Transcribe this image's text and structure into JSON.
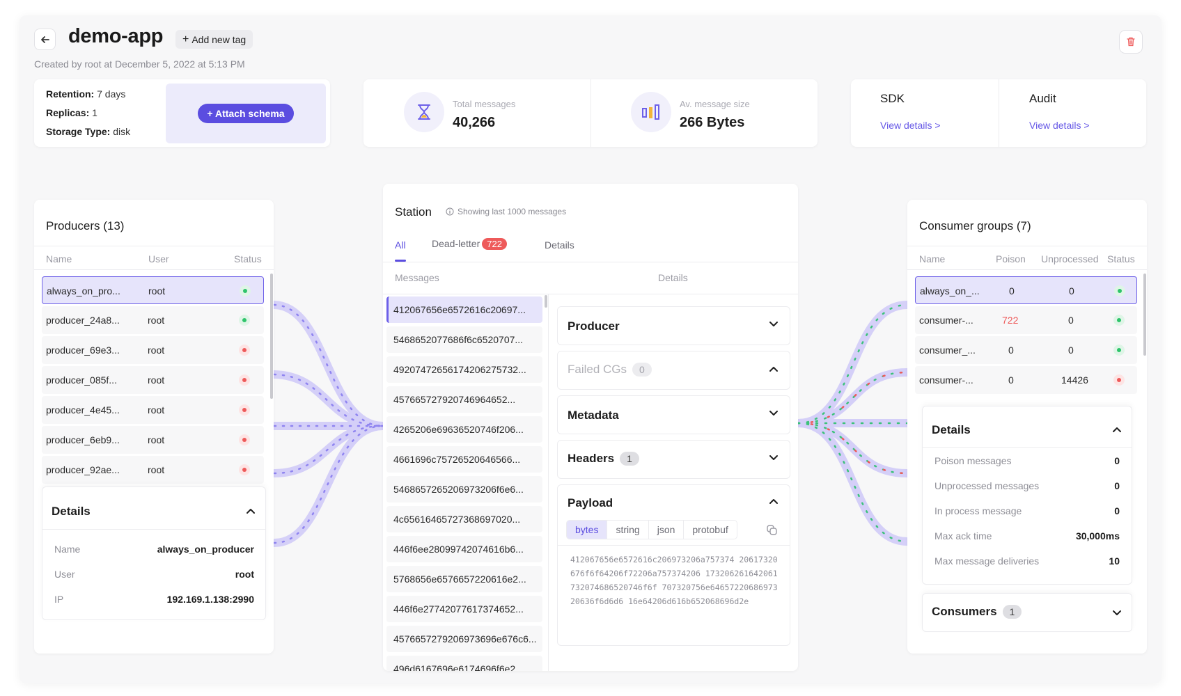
{
  "header": {
    "title": "demo-app",
    "add_tag_label": "Add new tag",
    "created": "Created by root at December 5, 2022 at 5:13 PM"
  },
  "info": {
    "retention_key": "Retention:",
    "retention_val": "7 days",
    "replicas_key": "Replicas:",
    "replicas_val": "1",
    "storage_key": "Storage Type:",
    "storage_val": "disk",
    "attach_schema_label": "+ Attach schema"
  },
  "stats": {
    "total_label": "Total messages",
    "total_value": "40,266",
    "size_label": "Av. message size",
    "size_value": "266 Bytes"
  },
  "links": {
    "sdk_title": "SDK",
    "sdk_link": "View details >",
    "audit_title": "Audit",
    "audit_link": "View details >"
  },
  "producers": {
    "title": "Producers (13)",
    "columns": [
      "Name",
      "User",
      "Status"
    ],
    "rows": [
      {
        "name": "always_on_pro...",
        "user": "root",
        "status": "ok"
      },
      {
        "name": "producer_24a8...",
        "user": "root",
        "status": "ok"
      },
      {
        "name": "producer_69e3...",
        "user": "root",
        "status": "bad"
      },
      {
        "name": "producer_085f...",
        "user": "root",
        "status": "bad"
      },
      {
        "name": "producer_4e45...",
        "user": "root",
        "status": "bad"
      },
      {
        "name": "producer_6eb9...",
        "user": "root",
        "status": "bad"
      },
      {
        "name": "producer_92ae...",
        "user": "root",
        "status": "bad"
      }
    ],
    "details": {
      "title": "Details",
      "name_key": "Name",
      "name_val": "always_on_producer",
      "user_key": "User",
      "user_val": "root",
      "ip_key": "IP",
      "ip_val": "192.169.1.138:2990"
    }
  },
  "station": {
    "title": "Station",
    "note": "Showing last 1000 messages",
    "tabs": {
      "all": "All",
      "dead_letter": "Dead-letter",
      "dead_letter_count": "722",
      "details": "Details"
    },
    "messages_header": "Messages",
    "details_header": "Details",
    "messages": [
      "412067656e6572616c20697...",
      "5468652077686f6c6520707...",
      "49207472656174206275732...",
      "457665727920746964652...",
      "4265206e69636520746f206...",
      "4661696c75726520646566...",
      "5468657265206973206f6e6...",
      "4c65616465727368697020...",
      "446f6ee28099742074616b6...",
      "5768656e6576657220616e2...",
      "446f6e27742077617374652...",
      "4576657279206973696e676c6...",
      "496d6167696e6174696f6e2..."
    ],
    "sections": {
      "producer": "Producer",
      "failed_cgs": "Failed CGs",
      "failed_cgs_count": "0",
      "metadata": "Metadata",
      "headers": "Headers",
      "headers_count": "1",
      "payload": "Payload"
    },
    "payload_formats": [
      "bytes",
      "string",
      "json",
      "protobuf"
    ],
    "payload_hex": "412067656e6572616c206973206a757374 20617320676f6f64206f72206a757374206 173206261642061732074686520746f6f 707320756e6465722068697320636f6d6d6 16e64206d616b652068696d2e"
  },
  "consumers": {
    "title": "Consumer groups (7)",
    "columns": [
      "Name",
      "Poison",
      "Unprocessed",
      "Status"
    ],
    "rows": [
      {
        "name": "always_on_...",
        "poison": "0",
        "unprocessed": "0",
        "status": "ok"
      },
      {
        "name": "consumer-...",
        "poison": "722",
        "unprocessed": "0",
        "status": "ok"
      },
      {
        "name": "consumer_...",
        "poison": "0",
        "unprocessed": "0",
        "status": "ok"
      },
      {
        "name": "consumer-...",
        "poison": "0",
        "unprocessed": "14426",
        "status": "bad"
      }
    ],
    "details": {
      "title": "Details",
      "poison_key": "Poison messages",
      "poison_val": "0",
      "unprocessed_key": "Unprocessed messages",
      "unprocessed_val": "0",
      "inprocess_key": "In process message",
      "inprocess_val": "0",
      "ack_key": "Max ack time",
      "ack_val": "30,000ms",
      "deliveries_key": "Max message deliveries",
      "deliveries_val": "10"
    },
    "consumers_label": "Consumers",
    "consumers_count": "1"
  },
  "colors": {
    "accent": "#5b4de0",
    "danger": "#ee5a5a",
    "success": "#2fc46b",
    "flow": "#c9c4f7"
  }
}
